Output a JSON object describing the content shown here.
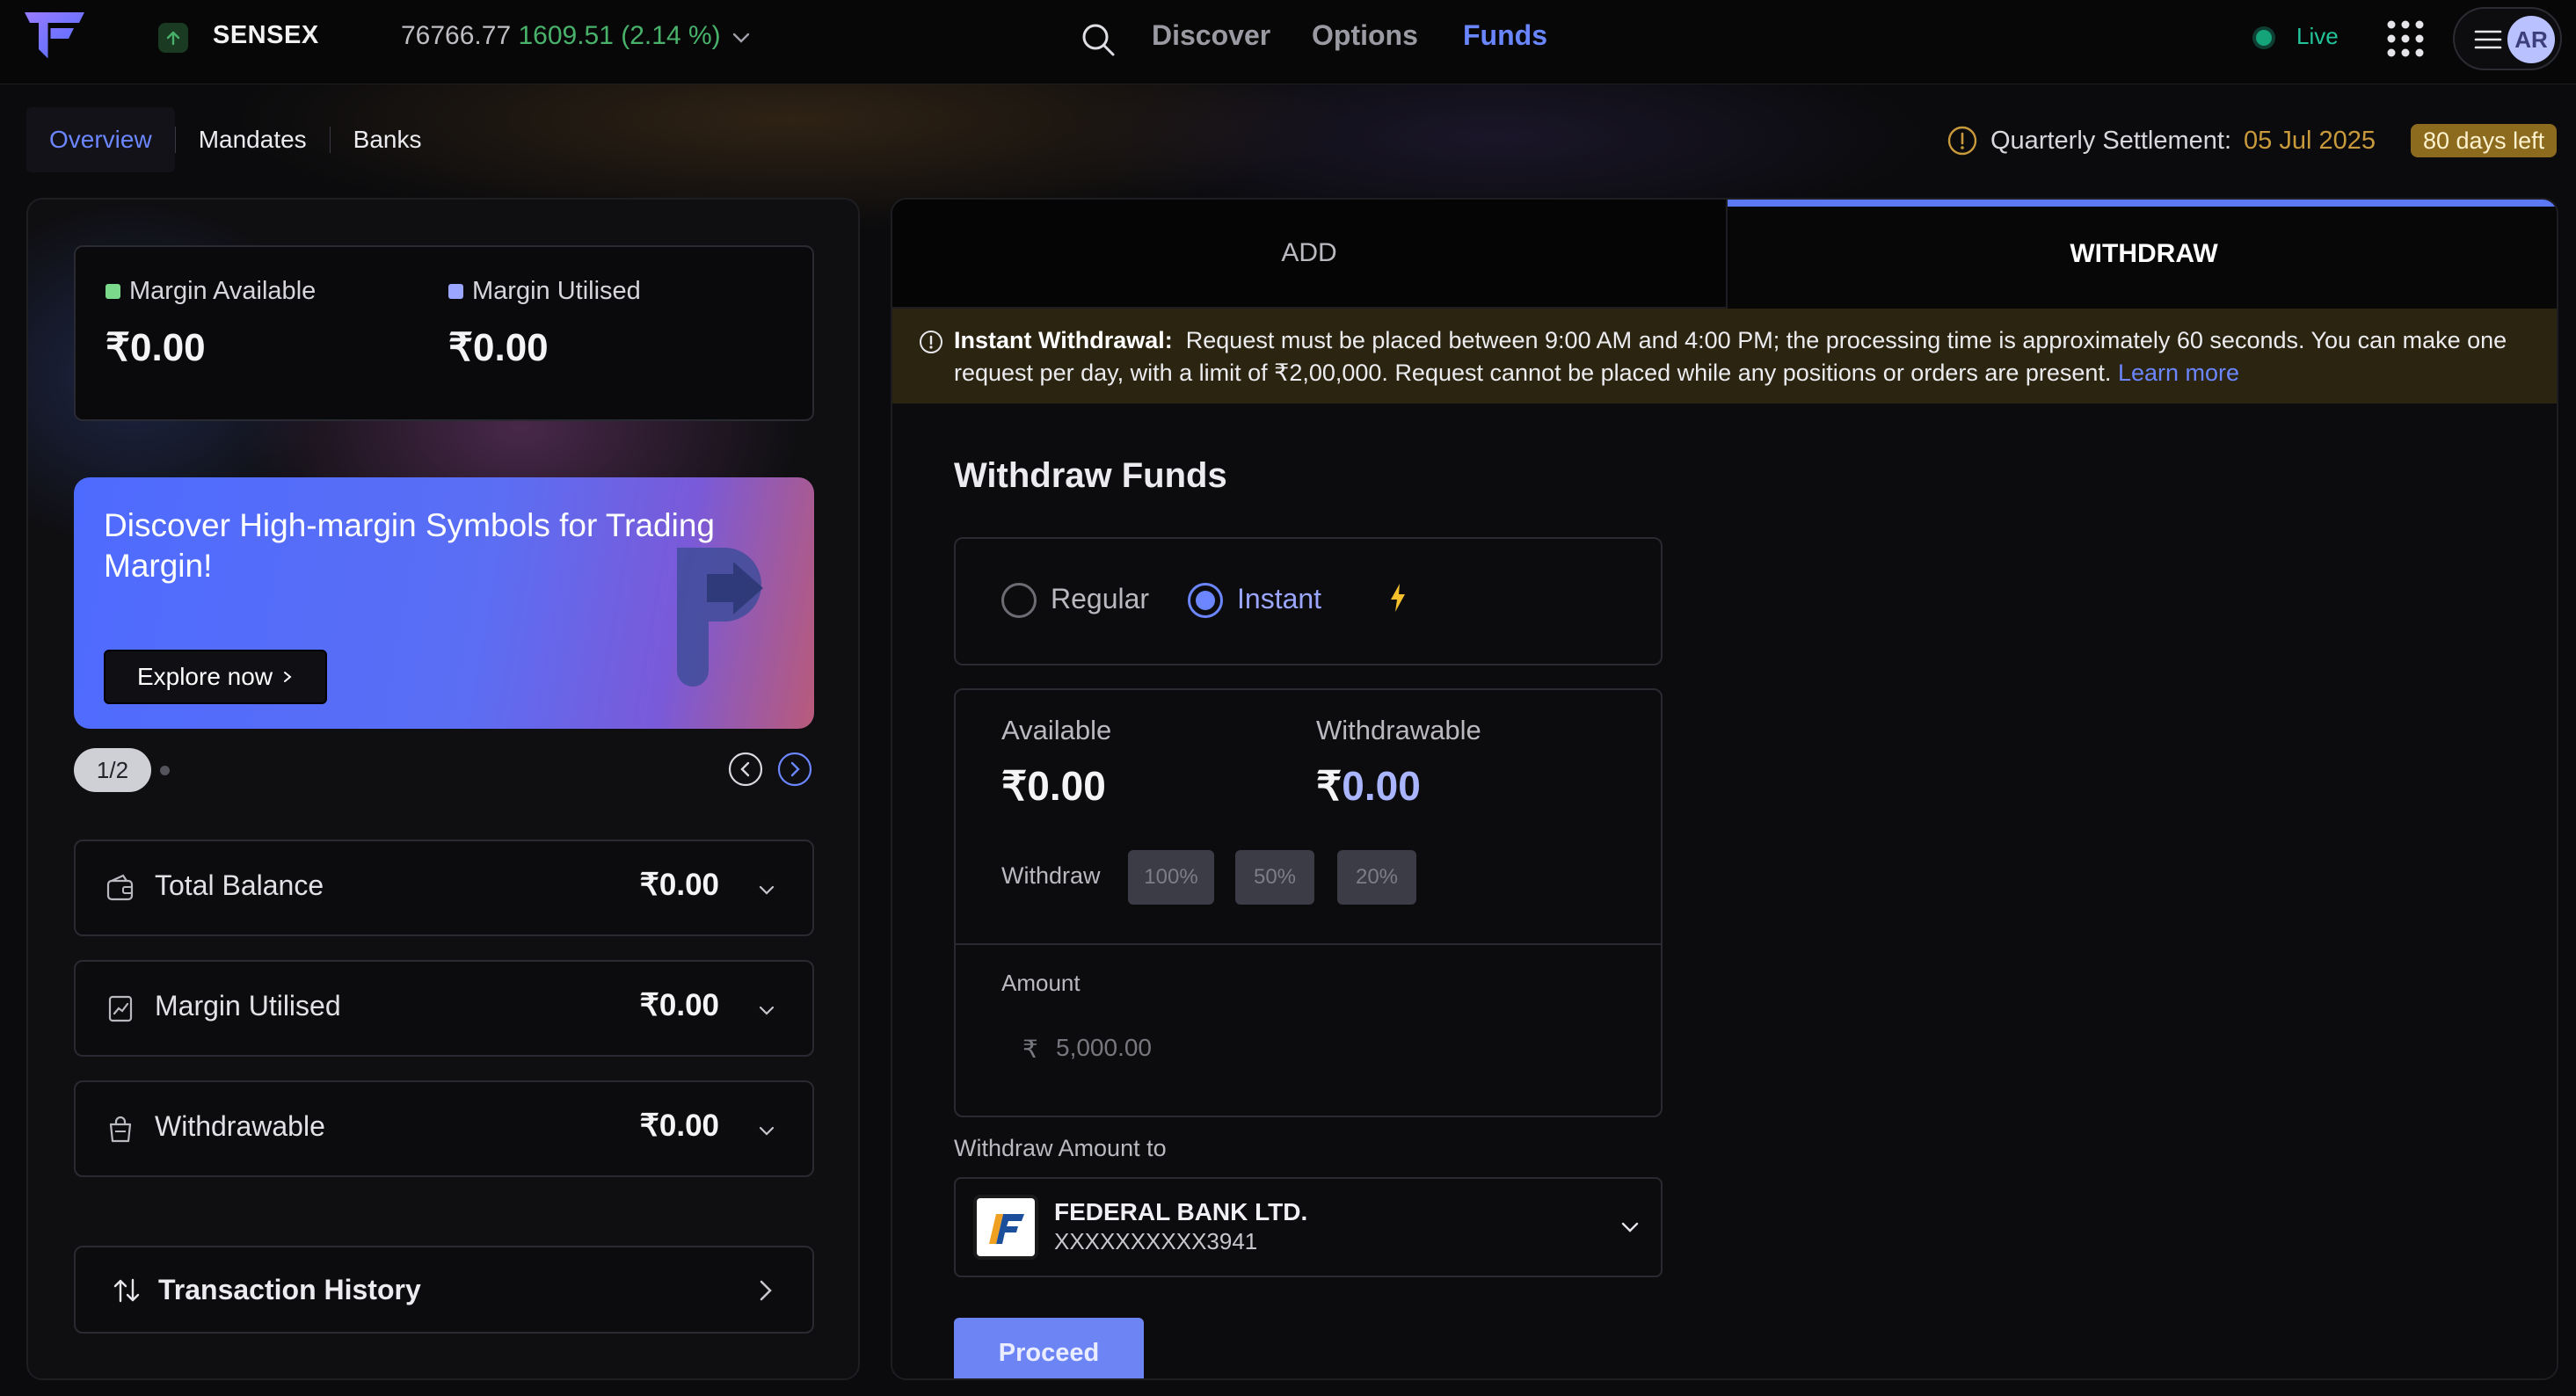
{
  "topbar": {
    "ticker": {
      "name": "SENSEX",
      "value": "76766.77",
      "change": "1609.51 (2.14 %)"
    },
    "nav": [
      "Discover",
      "Options",
      "Funds"
    ],
    "active_nav": "Funds",
    "status": "Live",
    "avatar_initials": "AR"
  },
  "subnav": {
    "tabs": [
      "Overview",
      "Mandates",
      "Banks"
    ],
    "active": "Overview",
    "settlement_label": "Quarterly Settlement:",
    "settlement_date": "05 Jul 2025",
    "days_left": "80 days left"
  },
  "left": {
    "margin_available_label": "Margin Available",
    "margin_available_value": "₹0.00",
    "margin_utilised_label": "Margin Utilised",
    "margin_utilised_value": "₹0.00",
    "promo_title": "Discover High-margin Symbols for Trading Margin!",
    "promo_button": "Explore now",
    "pager": "1/2",
    "accordions": [
      {
        "label": "Total Balance",
        "value": "₹0.00",
        "icon": "wallet-icon"
      },
      {
        "label": "Margin Utilised",
        "value": "₹0.00",
        "icon": "chart-receipt-icon"
      },
      {
        "label": "Withdrawable",
        "value": "₹0.00",
        "icon": "bag-icon"
      }
    ],
    "transaction_history": "Transaction History"
  },
  "right": {
    "tabs": {
      "add": "ADD",
      "withdraw": "WITHDRAW"
    },
    "active_tab": "WITHDRAW",
    "notice": {
      "title": "Instant Withdrawal:",
      "text": "Request must be placed between 9:00 AM and 4:00 PM; the processing time is approximately 60 seconds. You can make one request per day, with a limit of ₹2,00,000. Request cannot be placed while any positions or orders are present.",
      "link": "Learn more"
    },
    "title": "Withdraw Funds",
    "modes": {
      "regular": "Regular",
      "instant": "Instant",
      "selected": "Instant"
    },
    "available_label": "Available",
    "available_value": "₹0.00",
    "withdrawable_label": "Withdrawable",
    "withdrawable_symbol": "₹",
    "withdrawable_value": "0.00",
    "withdraw_label": "Withdraw",
    "percent_options": [
      "100%",
      "50%",
      "20%"
    ],
    "amount_label": "Amount",
    "amount_symbol": "₹",
    "amount_placeholder": "5,000.00",
    "withdraw_to_label": "Withdraw Amount to",
    "bank": {
      "name": "FEDERAL BANK LTD.",
      "account": "XXXXXXXXXX3941"
    },
    "proceed": "Proceed"
  },
  "colors": {
    "accent": "#6b86ff",
    "positive": "#49b26a",
    "warning": "#c99a3c",
    "live": "#23c49a"
  }
}
